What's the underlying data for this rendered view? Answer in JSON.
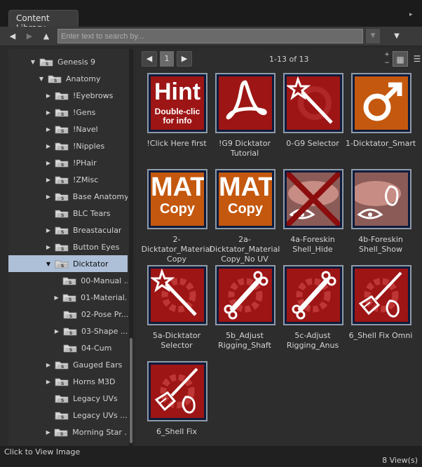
{
  "window": {
    "tab_title": "Content Library"
  },
  "toolbar": {
    "back_icon": "left-arrow",
    "forward_icon": "right-arrow",
    "up_icon": "up-arrow",
    "search_placeholder": "Enter text to search by...",
    "menu_icon": "dropdown"
  },
  "tree": {
    "items": [
      {
        "label": "Genesis 9",
        "expanded": true,
        "level": 0
      },
      {
        "label": "Anatomy",
        "expanded": true,
        "level": 1
      },
      {
        "label": "!Eyebrows",
        "expanded": false,
        "level": 2
      },
      {
        "label": "!Gens",
        "expanded": false,
        "level": 2
      },
      {
        "label": "!Navel",
        "expanded": false,
        "level": 2
      },
      {
        "label": "!Nipples",
        "expanded": false,
        "level": 2
      },
      {
        "label": "!PHair",
        "expanded": false,
        "level": 2
      },
      {
        "label": "!ZMisc",
        "expanded": false,
        "level": 2
      },
      {
        "label": "Base Anatomy",
        "expanded": false,
        "level": 2
      },
      {
        "label": "BLC Tears",
        "expanded": null,
        "level": 2
      },
      {
        "label": "Breastacular",
        "expanded": false,
        "level": 2
      },
      {
        "label": "Button Eyes",
        "expanded": false,
        "level": 2
      },
      {
        "label": "Dicktator",
        "expanded": true,
        "level": 2,
        "selected": true
      },
      {
        "label": "00-Manual ...",
        "expanded": null,
        "level": 3
      },
      {
        "label": "01-Material...",
        "expanded": false,
        "level": 3
      },
      {
        "label": "02-Pose Pr...",
        "expanded": null,
        "level": 3
      },
      {
        "label": "03-Shape ...",
        "expanded": false,
        "level": 3
      },
      {
        "label": "04-Cum",
        "expanded": null,
        "level": 3
      },
      {
        "label": "Gauged Ears",
        "expanded": false,
        "level": 2
      },
      {
        "label": "Horns M3D",
        "expanded": false,
        "level": 2
      },
      {
        "label": "Legacy UVs",
        "expanded": null,
        "level": 2
      },
      {
        "label": "Legacy UVs ...",
        "expanded": null,
        "level": 2
      },
      {
        "label": "Morning Star ...",
        "expanded": false,
        "level": 2
      }
    ]
  },
  "pager": {
    "current_page": "1",
    "count_text": "1-13 of 13"
  },
  "items": [
    {
      "label": "!Click Here first",
      "icon": "hint"
    },
    {
      "label": "!G9 Dicktator Tutorial",
      "icon": "pdf-icon"
    },
    {
      "label": "0-G9 Selector",
      "icon": "wand-icon"
    },
    {
      "label": "1-Dicktator_Smart",
      "icon": "male-symbol-icon"
    },
    {
      "label": "2-Dicktator_Material Copy",
      "icon": "mat-copy"
    },
    {
      "label": "2a-Dicktator_Material Copy_No UV",
      "icon": "mat-copy"
    },
    {
      "label": "4a-Foreskin Shell_Hide",
      "icon": "shell-hide"
    },
    {
      "label": "4b-Foreskin Shell_Show",
      "icon": "shell-show"
    },
    {
      "label": "5a-Dicktator Selector",
      "icon": "wand-gear-icon"
    },
    {
      "label": "5b_Adjust Rigging_Shaft",
      "icon": "bone-gear-icon"
    },
    {
      "label": "5c-Adjust Rigging_Anus",
      "icon": "bone-gear-icon"
    },
    {
      "label": "6_Shell Fix Omni",
      "icon": "brush-shell-icon"
    },
    {
      "label": "6_Shell Fix",
      "icon": "brush-shell-icon"
    }
  ],
  "thumb_text": {
    "hint_big": "Hint",
    "hint_small_1": "Double-clic",
    "hint_small_2": "for info",
    "mat_big": "MAT",
    "mat_small": "Copy"
  },
  "status": {
    "left": "Click to View Image",
    "right": "8 View(s)"
  },
  "colors": {
    "thumb_red": "#9d1515",
    "thumb_border": "#8f9ba8",
    "selected_row": "#aebfd8",
    "mat_orange": "#c45a0c"
  }
}
